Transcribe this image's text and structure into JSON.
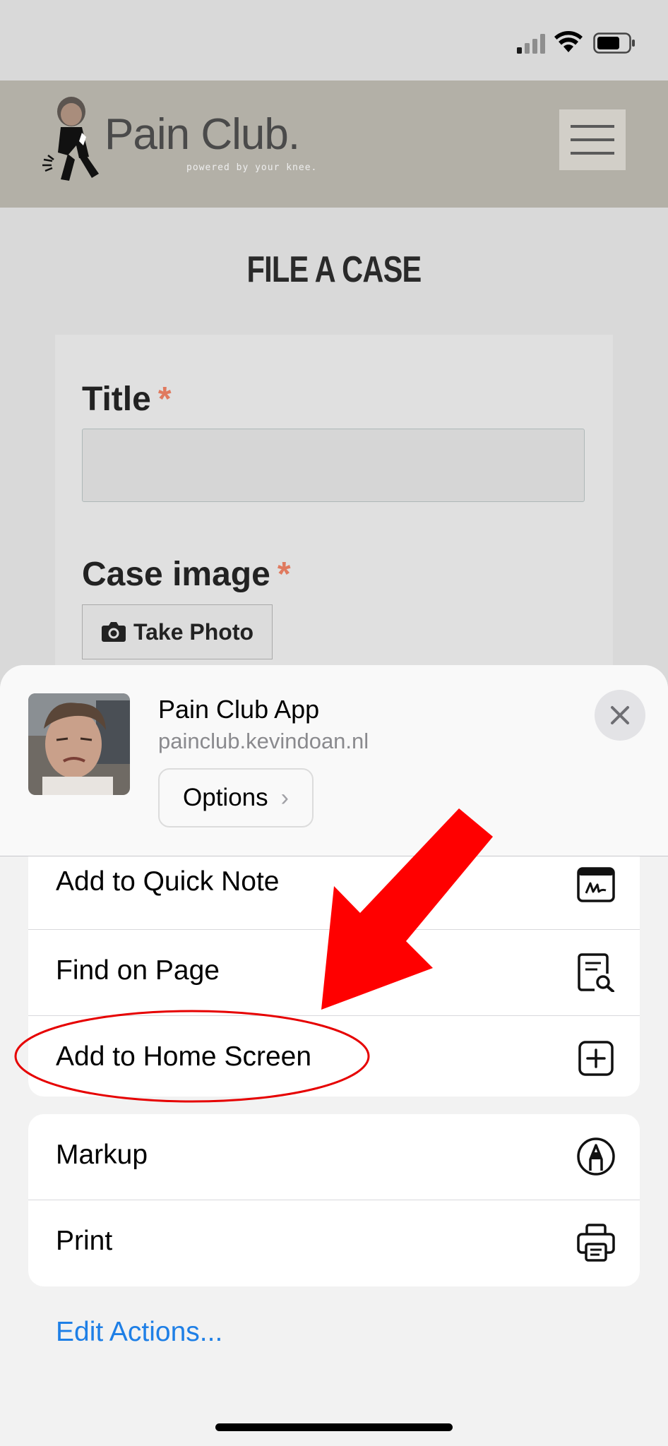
{
  "site": {
    "logo_text": "Pain Club.",
    "logo_tagline": "powered by your knee.",
    "menu_icon": "hamburger-icon"
  },
  "page": {
    "title": "FILE A CASE"
  },
  "form": {
    "title_label": "Title",
    "title_required": "*",
    "title_value": "",
    "image_label": "Case image",
    "image_required": "*",
    "take_photo_label": "Take Photo",
    "take_photo_icon": "camera-icon"
  },
  "share_sheet": {
    "app_name": "Pain Club App",
    "app_url": "painclub.kevindoan.nl",
    "options_label": "Options",
    "close_icon": "close-icon",
    "actions_group_1": [
      {
        "label": "Add to Quick Note",
        "icon": "quick-note-icon"
      },
      {
        "label": "Find on Page",
        "icon": "find-on-page-icon"
      },
      {
        "label": "Add to Home Screen",
        "icon": "add-square-icon"
      }
    ],
    "actions_group_2": [
      {
        "label": "Markup",
        "icon": "markup-icon"
      },
      {
        "label": "Print",
        "icon": "printer-icon"
      }
    ],
    "edit_actions_label": "Edit Actions..."
  },
  "colors": {
    "annotation_red": "#ff0000",
    "link_blue": "#1e7fe6",
    "required_orange": "#e07a5f",
    "header_bg": "#b3b0a7"
  }
}
